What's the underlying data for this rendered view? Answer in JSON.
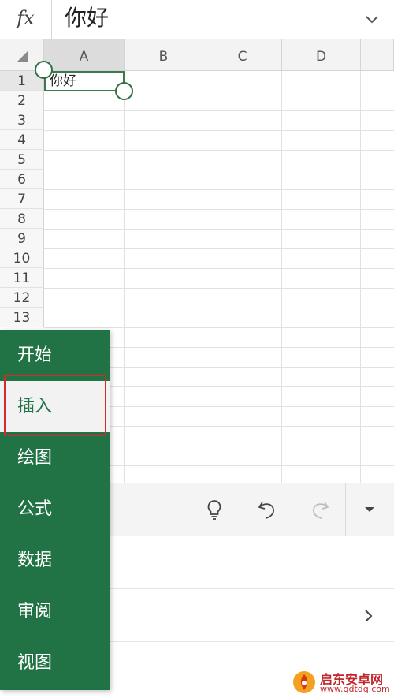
{
  "formula_bar": {
    "fx_label": "fx",
    "value": "你好"
  },
  "grid": {
    "columns": [
      "A",
      "B",
      "C",
      "D"
    ],
    "rows": [
      "1",
      "2",
      "3",
      "4",
      "5",
      "6",
      "7",
      "8",
      "9",
      "10",
      "11",
      "12",
      "13"
    ],
    "cell_a1": "你好"
  },
  "tab_menu": {
    "items": [
      "开始",
      "插入",
      "绘图",
      "公式",
      "数据",
      "审阅",
      "视图"
    ],
    "selected": "插入"
  },
  "watermark": {
    "main": "启东安卓网",
    "sub": "www.qdtdq.com"
  },
  "colors": {
    "excel_green": "#217346",
    "highlight_red": "#d22b2b",
    "selection_green": "#3a7a4b"
  },
  "icons": {
    "formula_chevron": "chevron-down-icon",
    "ideas": "lightbulb-icon",
    "undo": "undo-icon",
    "redo": "redo-icon",
    "more": "caret-down-icon",
    "panel_chevron": "chevron-right-icon"
  }
}
